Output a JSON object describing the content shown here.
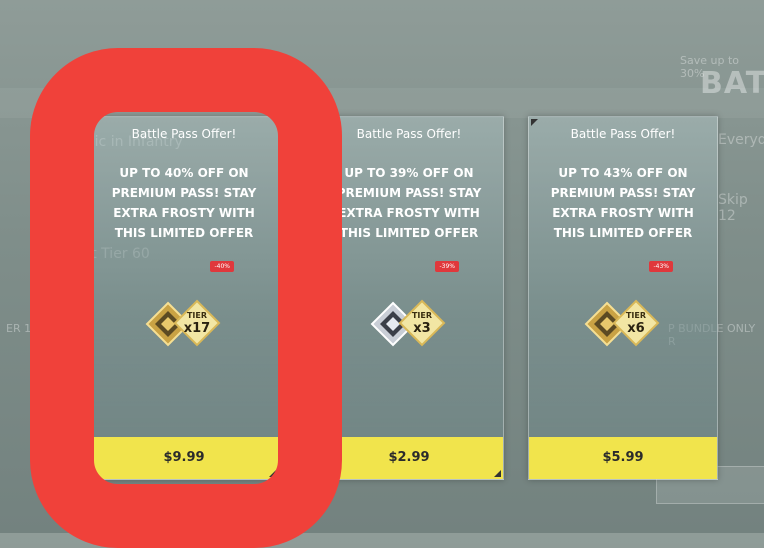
{
  "background": {
    "top_right_small": "Save up to 30%",
    "top_right_big": "BATTL",
    "left_row_1": "al Epic in Infantry",
    "left_row_2": "CP at Tier 60",
    "left_row_3": "ER 1 R  LOCK RE",
    "right_row_1": "Everyd",
    "right_row_2": "Skip 12",
    "right_row_3": "P BUNDLE ONLY R"
  },
  "cards": [
    {
      "title": "Battle Pass Offer!",
      "description": "UP TO 40% OFF ON PREMIUM PASS! STAY EXTRA FROSTY WITH THIS LIMITED OFFER",
      "discount": "-40%",
      "tier_label": "TIER",
      "tier_count": "x17",
      "price": "$9.99",
      "pass_style": "gold"
    },
    {
      "title": "Battle Pass Offer!",
      "description": "UP TO 39% OFF ON PREMIUM PASS! STAY EXTRA FROSTY WITH THIS LIMITED OFFER",
      "discount": "-39%",
      "tier_label": "TIER",
      "tier_count": "x3",
      "price": "$2.99",
      "pass_style": "silver"
    },
    {
      "title": "Battle Pass Offer!",
      "description": "UP TO 43% OFF ON PREMIUM PASS! STAY EXTRA FROSTY WITH THIS LIMITED OFFER",
      "discount": "-43%",
      "tier_label": "TIER",
      "tier_count": "x6",
      "price": "$5.99",
      "pass_style": "gold"
    }
  ],
  "colors": {
    "price_bar": "#f1e44c",
    "highlight": "#f0413a",
    "discount": "#e0383c"
  }
}
